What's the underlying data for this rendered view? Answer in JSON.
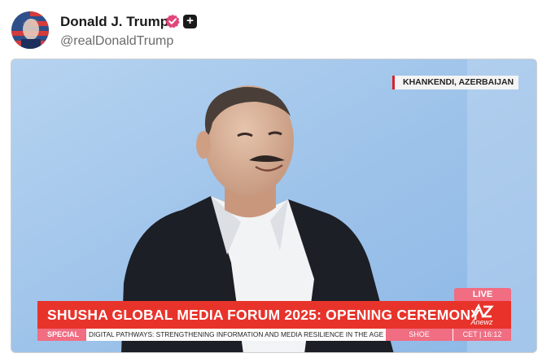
{
  "post": {
    "display_name": "Donald J. Trump",
    "handle": "@realDonaldTrump",
    "avatar_icon": "flag-portrait-avatar",
    "verified_icon": "verified-badge-icon",
    "plus_icon": "plus-icon",
    "plus_glyph": "+"
  },
  "video": {
    "location": "KHANKENDI, AZERBAIJAN",
    "live_label": "LIVE",
    "headline": "SHUSHA GLOBAL MEDIA FORUM 2025: OPENING CEREMONY",
    "logo_text": "Anewz",
    "ticker": {
      "label": "SPECIAL",
      "text": "DIGITAL PATHWAYS: STRENGTHENING INFORMATION AND MEDIA RESILIENCE IN THE AGE OF AI",
      "segment": "SHOE",
      "time": "CET | 16:12"
    }
  },
  "colors": {
    "headline_red": "#e8332b",
    "live_pink": "#f06d82",
    "verified_pink": "#e0457b",
    "background_blue": "#a9c9ea"
  }
}
